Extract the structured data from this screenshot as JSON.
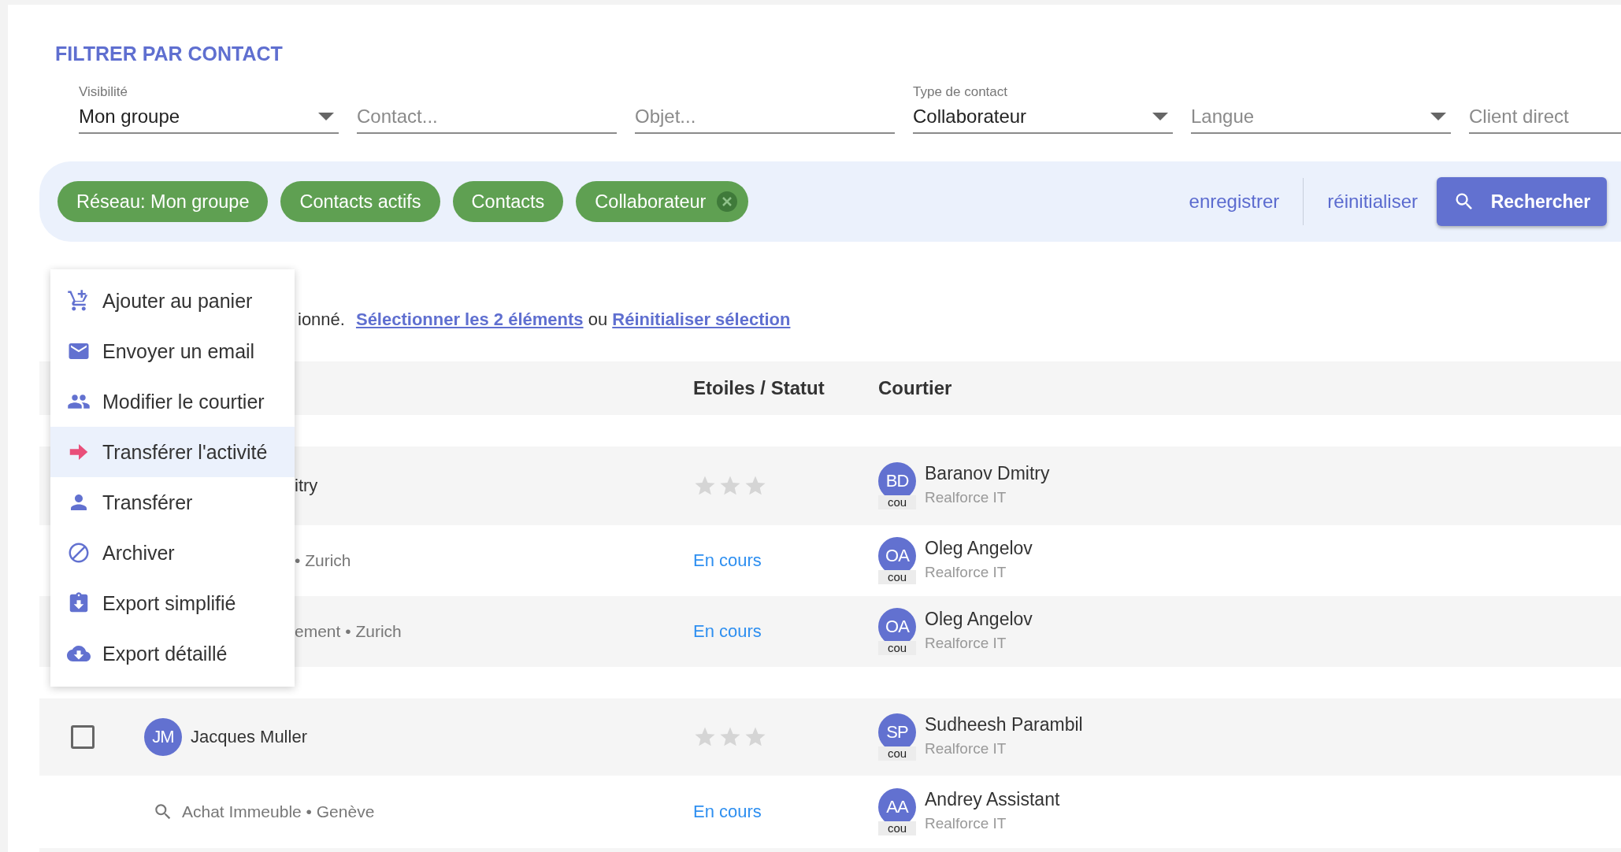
{
  "filter_title": "FILTRER PAR CONTACT",
  "fields": [
    {
      "kind": "select",
      "label": "Visibilité",
      "value": "Mon groupe"
    },
    {
      "kind": "text",
      "placeholder": "Contact..."
    },
    {
      "kind": "text",
      "placeholder": "Objet..."
    },
    {
      "kind": "select",
      "label": "Type de contact",
      "value": "Collaborateur"
    },
    {
      "kind": "select",
      "placeholder": "Langue"
    },
    {
      "kind": "text",
      "placeholder": "Client direct"
    }
  ],
  "chips": [
    {
      "label": "Réseau: Mon groupe",
      "removable": false
    },
    {
      "label": "Contacts actifs",
      "removable": false
    },
    {
      "label": "Contacts",
      "removable": false
    },
    {
      "label": "Collaborateur",
      "removable": true
    }
  ],
  "actions": {
    "save": "enregistrer",
    "reset": "réinitialiser",
    "search": "Rechercher"
  },
  "selection_bar": {
    "text": "ionné.",
    "select_all": "Sélectionner les 2 éléments",
    "separator": "ou",
    "reset": "Réinitialiser sélection"
  },
  "table": {
    "columns": [
      "Etoiles / Statut",
      "Courtier"
    ],
    "groups": [
      {
        "rows": [
          {
            "kind": "contact",
            "name": "itry",
            "stars": 0,
            "broker": {
              "initials": "BD",
              "name": "Baranov Dmitry",
              "role": "cou",
              "company": "Realforce IT"
            }
          },
          {
            "kind": "activity",
            "has_icon": false,
            "text": "• Zurich",
            "status": "En cours",
            "broker": {
              "initials": "OA",
              "name": "Oleg Angelov",
              "role": "cou",
              "company": "Realforce IT"
            }
          },
          {
            "kind": "activity",
            "has_icon": false,
            "text": "ement • Zurich",
            "status": "En cours",
            "broker": {
              "initials": "OA",
              "name": "Oleg Angelov",
              "role": "cou",
              "company": "Realforce IT"
            }
          }
        ]
      },
      {
        "rows": [
          {
            "kind": "contact",
            "checked": false,
            "initials": "JM",
            "name": "Jacques Muller",
            "stars": 0,
            "broker": {
              "initials": "SP",
              "name": "Sudheesh Parambil",
              "role": "cou",
              "company": "Realforce IT"
            }
          },
          {
            "kind": "activity",
            "has_icon": true,
            "text": "Achat Immeuble • Genève",
            "status": "En cours",
            "broker": {
              "initials": "AA",
              "name": "Andrey Assistant",
              "role": "cou",
              "company": "Realforce IT"
            }
          }
        ]
      }
    ]
  },
  "menu": {
    "items": [
      {
        "kind": "cart",
        "label": "Ajouter au panier",
        "selected": false
      },
      {
        "kind": "email",
        "label": "Envoyer un email",
        "selected": false
      },
      {
        "kind": "people",
        "label": "Modifier le courtier",
        "selected": false
      },
      {
        "kind": "arrow",
        "label": "Transférer l'activité",
        "selected": true
      },
      {
        "kind": "person",
        "label": "Transférer",
        "selected": false
      },
      {
        "kind": "block",
        "label": "Archiver",
        "selected": false
      },
      {
        "kind": "clipboard",
        "label": "Export simplifié",
        "selected": false
      },
      {
        "kind": "cloud",
        "label": "Export détaillé",
        "selected": false
      }
    ]
  }
}
